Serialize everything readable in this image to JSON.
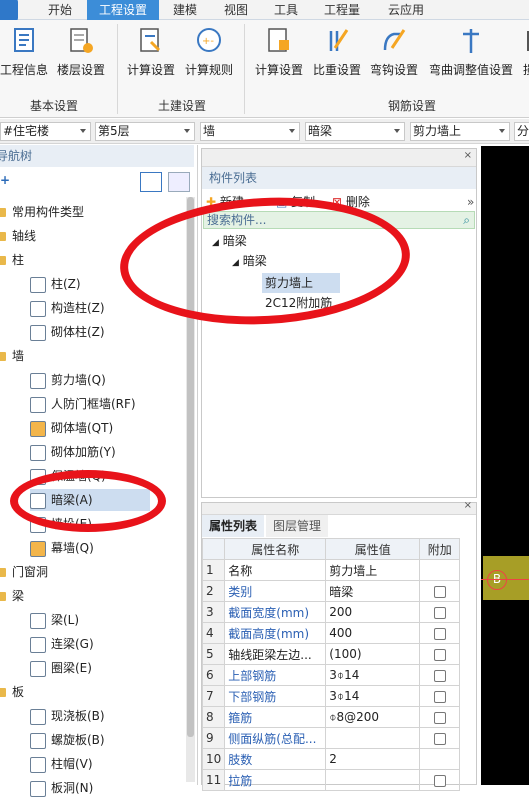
{
  "tabs": [
    "开始",
    "工程设置",
    "建模",
    "视图",
    "工具",
    "工程量",
    "云应用"
  ],
  "active_tab": "工程设置",
  "ribbon": {
    "buttons": [
      "工程信息",
      "楼层设置",
      "计算设置",
      "计算规则",
      "计算设置",
      "比重设置",
      "弯钩设置",
      "弯曲调整值设置",
      "损"
    ],
    "groups": [
      "基本设置",
      "土建设置",
      "钢筋设置"
    ]
  },
  "selectors": [
    "#住宅楼",
    "第5层",
    "墙",
    "暗梁",
    "剪力墙上",
    "分"
  ],
  "nav": {
    "title": "导航树",
    "items": [
      {
        "label": "常用构件类型",
        "type": "folder"
      },
      {
        "label": "轴线",
        "type": "folder"
      },
      {
        "label": "柱",
        "type": "folder"
      },
      {
        "label": "柱(Z)",
        "type": "leaf"
      },
      {
        "label": "构造柱(Z)",
        "type": "leaf"
      },
      {
        "label": "砌体柱(Z)",
        "type": "leaf"
      },
      {
        "label": "墙",
        "type": "folder"
      },
      {
        "label": "剪力墙(Q)",
        "type": "leaf"
      },
      {
        "label": "人防门框墙(RF)",
        "type": "leaf"
      },
      {
        "label": "砌体墙(QT)",
        "type": "leaf"
      },
      {
        "label": "砌体加筋(Y)",
        "type": "leaf"
      },
      {
        "label": "保温墙(Q)",
        "type": "leaf"
      },
      {
        "label": "暗梁(A)",
        "type": "leaf",
        "selected": true
      },
      {
        "label": "墙垛(E)",
        "type": "leaf"
      },
      {
        "label": "幕墙(Q)",
        "type": "leaf"
      },
      {
        "label": "门窗洞",
        "type": "folder"
      },
      {
        "label": "梁",
        "type": "folder"
      },
      {
        "label": "梁(L)",
        "type": "leaf"
      },
      {
        "label": "连梁(G)",
        "type": "leaf"
      },
      {
        "label": "圈梁(E)",
        "type": "leaf"
      },
      {
        "label": "板",
        "type": "folder"
      },
      {
        "label": "现浇板(B)",
        "type": "leaf"
      },
      {
        "label": "螺旋板(B)",
        "type": "leaf"
      },
      {
        "label": "柱帽(V)",
        "type": "leaf"
      },
      {
        "label": "板洞(N)",
        "type": "leaf"
      }
    ]
  },
  "components": {
    "title": "构件列表",
    "new_label": "新建",
    "copy_label": "复制",
    "delete_label": "删除",
    "search_placeholder": "搜索构件...",
    "tree": [
      "暗梁",
      "暗梁",
      "剪力墙上",
      "2C12附加筋"
    ]
  },
  "props": {
    "tab_active": "属性列表",
    "tab_other": "图层管理",
    "headers": [
      "属性名称",
      "属性值",
      "附加"
    ],
    "rows": [
      {
        "n": "1",
        "name": "名称",
        "value": "剪力墙上",
        "blue": false,
        "cb": false
      },
      {
        "n": "2",
        "name": "类别",
        "value": "暗梁",
        "blue": true,
        "cb": true
      },
      {
        "n": "3",
        "name": "截面宽度(mm)",
        "value": "200",
        "blue": true,
        "cb": true
      },
      {
        "n": "4",
        "name": "截面高度(mm)",
        "value": "400",
        "blue": true,
        "cb": true
      },
      {
        "n": "5",
        "name": "轴线距梁左边...",
        "value": "(100)",
        "blue": false,
        "cb": true
      },
      {
        "n": "6",
        "name": "上部钢筋",
        "value": "3⌽14",
        "blue": true,
        "cb": true
      },
      {
        "n": "7",
        "name": "下部钢筋",
        "value": "3⌽14",
        "blue": true,
        "cb": true
      },
      {
        "n": "8",
        "name": "箍筋",
        "value": "⌽8@200",
        "blue": true,
        "cb": true
      },
      {
        "n": "9",
        "name": "侧面纵筋(总配...",
        "value": "",
        "blue": true,
        "cb": true
      },
      {
        "n": "10",
        "name": "肢数",
        "value": "2",
        "blue": true,
        "cb": false
      },
      {
        "n": "11",
        "name": "拉筋",
        "value": "",
        "blue": true,
        "cb": true
      }
    ]
  },
  "canvas": {
    "marker": "B"
  }
}
